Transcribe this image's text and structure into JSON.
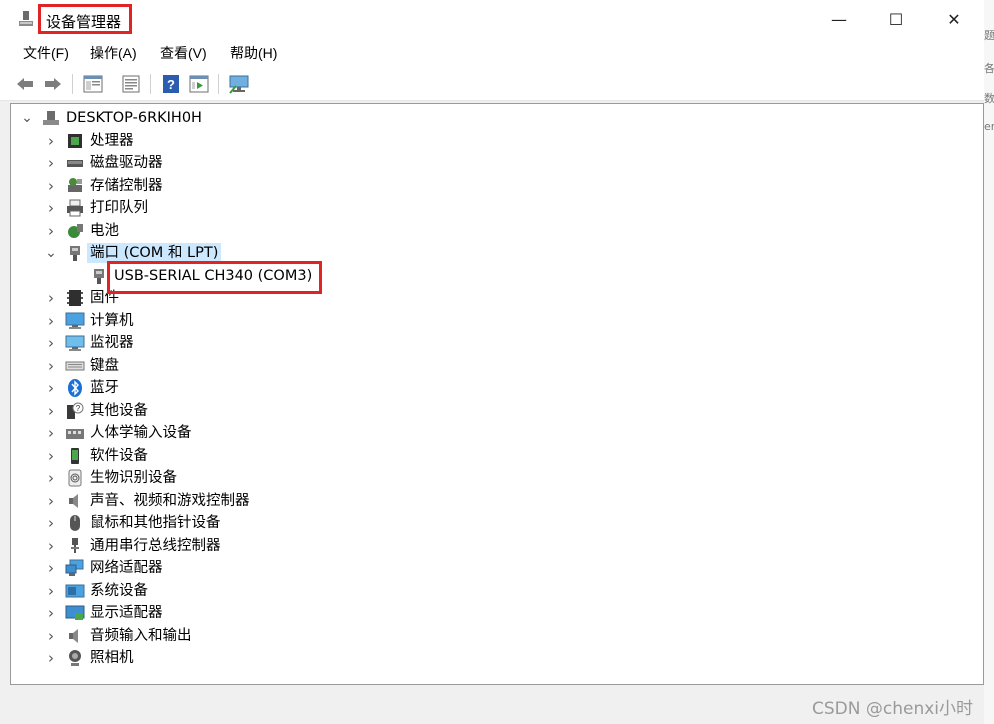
{
  "window": {
    "title": "设备管理器",
    "minimize_glyph": "—",
    "maximize_glyph": "☐",
    "close_glyph": "✕"
  },
  "menu": [
    {
      "label": "文件(F)"
    },
    {
      "label": "操作(A)"
    },
    {
      "label": "查看(V)"
    },
    {
      "label": "帮助(H)"
    }
  ],
  "toolbar": {
    "buttons": [
      "back-icon",
      "forward-icon",
      "show-hide-tree-icon",
      "properties-icon",
      "help-icon",
      "run-icon",
      "scan-hardware-icon"
    ]
  },
  "tree": {
    "root": {
      "label": "DESKTOP-6RKIH0H",
      "expanded": true,
      "icon": "computer-icon"
    },
    "items": [
      {
        "label": "处理器",
        "icon": "processor-icon"
      },
      {
        "label": "磁盘驱动器",
        "icon": "disk-drive-icon"
      },
      {
        "label": "存储控制器",
        "icon": "storage-controller-icon"
      },
      {
        "label": "打印队列",
        "icon": "printer-icon"
      },
      {
        "label": "电池",
        "icon": "battery-icon"
      },
      {
        "label": "端口 (COM 和 LPT)",
        "icon": "port-icon",
        "expanded": true,
        "selected": true,
        "children": [
          {
            "label": "USB-SERIAL CH340 (COM3)",
            "icon": "port-icon"
          }
        ]
      },
      {
        "label": "固件",
        "icon": "firmware-icon"
      },
      {
        "label": "计算机",
        "icon": "computer-monitor-icon"
      },
      {
        "label": "监视器",
        "icon": "monitor-icon"
      },
      {
        "label": "键盘",
        "icon": "keyboard-icon"
      },
      {
        "label": "蓝牙",
        "icon": "bluetooth-icon"
      },
      {
        "label": "其他设备",
        "icon": "unknown-device-icon"
      },
      {
        "label": "人体学输入设备",
        "icon": "hid-icon"
      },
      {
        "label": "软件设备",
        "icon": "software-device-icon"
      },
      {
        "label": "生物识别设备",
        "icon": "fingerprint-icon"
      },
      {
        "label": "声音、视频和游戏控制器",
        "icon": "speaker-icon"
      },
      {
        "label": "鼠标和其他指针设备",
        "icon": "mouse-icon"
      },
      {
        "label": "通用串行总线控制器",
        "icon": "usb-icon"
      },
      {
        "label": "网络适配器",
        "icon": "network-adapter-icon"
      },
      {
        "label": "系统设备",
        "icon": "system-device-icon"
      },
      {
        "label": "显示适配器",
        "icon": "display-adapter-icon"
      },
      {
        "label": "音频输入和输出",
        "icon": "audio-io-icon"
      },
      {
        "label": "照相机",
        "icon": "camera-icon"
      }
    ]
  },
  "watermark": "CSDN @chenxi小时",
  "right_edge_glyphs": [
    "题",
    "各",
    "数",
    "er"
  ],
  "colors": {
    "highlight_red": "#e02424",
    "selection": "#cce8ff"
  }
}
